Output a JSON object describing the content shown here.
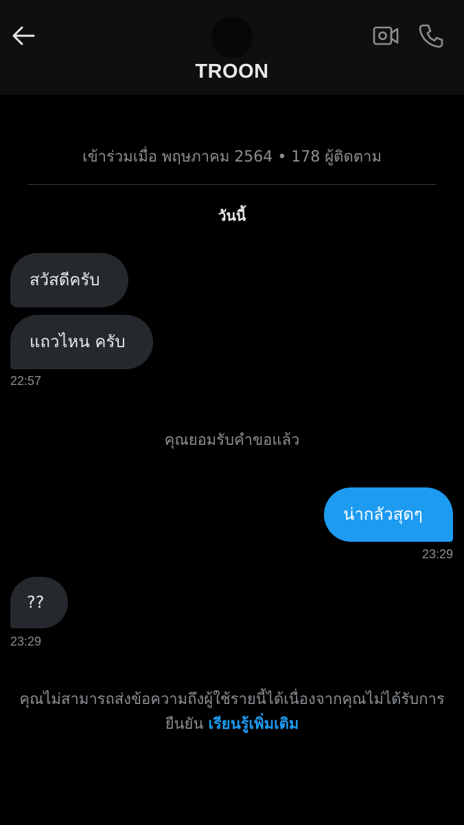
{
  "header": {
    "title": "TROON",
    "back_icon": "arrow-left-icon",
    "video_icon": "video-camera-icon",
    "call_icon": "phone-icon"
  },
  "profile": {
    "joined": "เข้าร่วมเมื่อ พฤษภาคม 2564",
    "separator": "•",
    "followers": "178 ผู้ติดตาม"
  },
  "date_label": "วันนี้",
  "messages": [
    {
      "direction": "incoming",
      "text": "สวัสดีครับ"
    },
    {
      "direction": "incoming",
      "text": "แถวไหน ครับ",
      "time": "22:57"
    },
    {
      "direction": "outgoing",
      "text": "น่ากลัวสุดๆ",
      "time": "23:29"
    },
    {
      "direction": "incoming",
      "text": "??",
      "time": "23:29"
    }
  ],
  "system_note": "คุณยอมรับคำขอแล้ว",
  "footer": {
    "text": "คุณไม่สามารถส่งข้อความถึงผู้ใช้รายนี้ได้เนื่องจากคุณไม่ได้รับการยืนยัน",
    "link": "เรียนรู้เพิ่มเติม"
  },
  "colors": {
    "background": "#000000",
    "header_bg": "#0f0f0f",
    "incoming_bubble": "#25292d",
    "outgoing_bubble": "#1d9bf0",
    "muted_text": "#8b8f93",
    "link": "#1d9bf0"
  }
}
